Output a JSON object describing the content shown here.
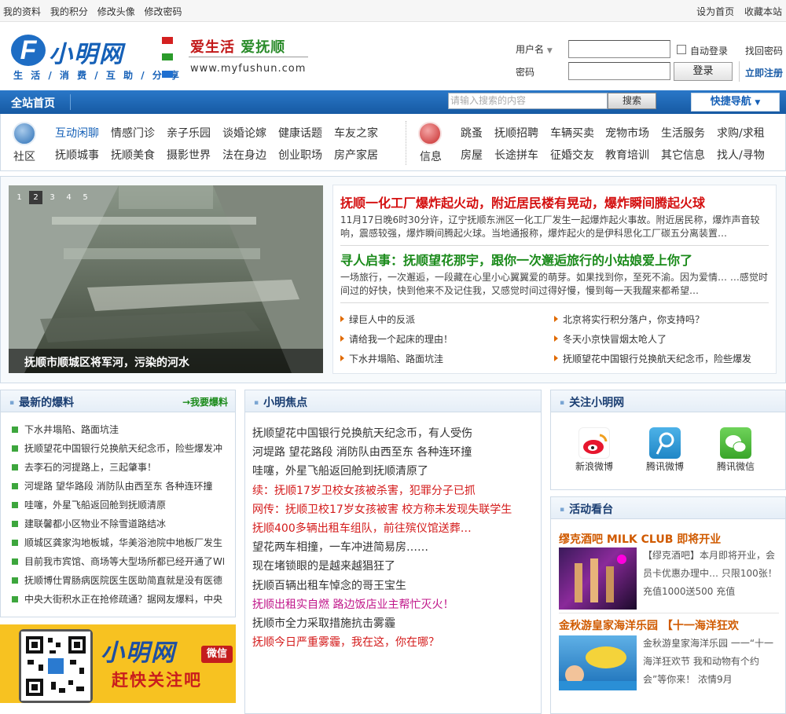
{
  "topbar": {
    "left_links": [
      "我的资料",
      "我的积分",
      "修改头像",
      "修改密码"
    ],
    "right_links": [
      "设为首页",
      "收藏本站"
    ]
  },
  "logo": {
    "f": "F",
    "name": "小明网",
    "tagline": "生 活 / 消 费 / 互 助 / 分 享"
  },
  "slogan": {
    "part1": "爱生活",
    "part2": "爱抚顺",
    "url": "www.myfushun.com"
  },
  "login": {
    "username_label": "用户名",
    "password_label": "密码",
    "auto_login": "自动登录",
    "login_button": "登录",
    "find_password": "找回密码",
    "register": "立即注册"
  },
  "nav": {
    "home": "全站首页",
    "search_placeholder": "请输入搜索的内容",
    "search_button": "搜索",
    "quick_nav": "快捷导航"
  },
  "community": {
    "label": "社区",
    "row1": [
      "互动闲聊",
      "情感门诊",
      "亲子乐园",
      "谈婚论嫁",
      "健康话题",
      "车友之家"
    ],
    "row2": [
      "抚顺城事",
      "抚顺美食",
      "摄影世界",
      "法在身边",
      "创业职场",
      "房产家居"
    ]
  },
  "info": {
    "label": "信息",
    "row1": [
      "跳蚤",
      "抚顺招聘",
      "车辆买卖",
      "宠物市场",
      "生活服务",
      "求购/求租"
    ],
    "row2": [
      "房屋",
      "长途拼车",
      "征婚交友",
      "教育培训",
      "其它信息",
      "找人/寻物"
    ]
  },
  "slideshow": {
    "numbers": [
      "1",
      "2",
      "3",
      "4",
      "5"
    ],
    "caption": "抚顺市顺城区将军河，污染的河水"
  },
  "headlines": [
    {
      "title": "抚顺一化工厂爆炸起火动，附近居民楼有晃动，爆炸瞬间腾起火球",
      "summary": "11月17日晚6时30分许，辽宁抚顺东洲区一化工厂发生一起爆炸起火事故。附近居民称，爆炸声音较响，震感较强，爆炸瞬间腾起火球。当地通报称，爆炸起火的是伊科思化工厂碳五分离装置…"
    },
    {
      "title": "寻人启事：抚顺望花那宇，跟你一次邂逅旅行的小姑娘爱上你了",
      "summary": "一场旅行，一次邂逅，一段藏在心里小心翼翼爱的萌芽。如果找到你，至死不渝。因为爱情… …感觉时间过的好快，快到他来不及记住我，又感觉时间过得好慢，慢到每一天我醒来都希望…"
    }
  ],
  "headline_links_left": [
    "绿巨人中的反派",
    "请给我一个起床的理由！",
    "下水井塌陷、路面坑洼"
  ],
  "headline_links_right": [
    "北京将实行积分落户，你支持吗？",
    "冬天小京快冒烟太呛人了",
    "抚顺望花中国银行兑换航天纪念币，险些爆发"
  ],
  "baoliao": {
    "title": "最新的爆料",
    "action": "→我要爆料",
    "items": [
      "下水井塌陷、路面坑洼",
      "抚顺望花中国银行兑换航天纪念币，险些爆发冲",
      "去李石的河提路上，三起肇事！",
      "河堤路 望华路段 消防队由西至东 各种连环撞",
      "哇噻，外星飞船返回舱到抚顺清原",
      "建联馨都小区物业不除雪道路结冰",
      "顺城区龚家沟地板城，华美浴池院中地板厂发生",
      "目前我市宾馆、商场等大型场所都已经开通了WI",
      "抚顺博仕胃肠病医院医生医助简直就是没有医德",
      "中央大街积水正在抢修疏通？据网友爆料，中央"
    ]
  },
  "banner": {
    "title": "小明网",
    "subtitle": "赶快关注吧",
    "tag": "微信"
  },
  "focus": {
    "title": "小明焦点",
    "items": [
      {
        "text": "抚顺望花中国银行兑换航天纪念币，有人受伤",
        "style": "normal"
      },
      {
        "text": "河堤路 望花路段 消防队由西至东 各种连环撞",
        "style": "normal"
      },
      {
        "text": "哇噻，外星飞船返回舱到抚顺清原了",
        "style": "normal"
      },
      {
        "text": "续：抚顺17岁卫校女孩被杀害，犯罪分子已抓",
        "style": "red"
      },
      {
        "text": "网传：抚顺卫校17岁女孩被害 校方称未发现失联学生",
        "style": "red"
      },
      {
        "text": "抚顺400多辆出租车组队，前往殡仪馆送葬…",
        "style": "red"
      },
      {
        "text": "望花两车相撞，一车冲进简易房……",
        "style": "normal"
      },
      {
        "text": "现在堵锁眼的是越来越猖狂了",
        "style": "normal"
      },
      {
        "text": "抚顺百辆出租车悼念的哥王宝生",
        "style": "normal"
      },
      {
        "text": "抚顺出租实自燃 路边饭店业主帮忙灭火！",
        "style": "mag"
      },
      {
        "text": "抚顺市全力采取措施抗击雾霾",
        "style": "normal"
      },
      {
        "text": "抚顺今日严重雾霾，我在这，你在哪？",
        "style": "red"
      }
    ]
  },
  "follow": {
    "title": "关注小明网",
    "items": [
      "新浪微博",
      "腾讯微博",
      "腾讯微信"
    ]
  },
  "events": {
    "title": "活动看台",
    "items": [
      {
        "title": "缪克酒吧 MILK CLUB 即将开业",
        "text": "【缪克酒吧】本月即将开业，会员卡优惠办理中… 只限100张！充值1000送500 充值"
      },
      {
        "title": "金秋游皇家海洋乐园 【十一海洋狂欢",
        "text": "金秋游皇家海洋乐园 一一“十一海洋狂欢节 我和动物有个约会”等你来！ 浓情9月"
      }
    ]
  },
  "colors": {
    "brand_blue": "#1560b7",
    "headline_red": "#d40f0f",
    "headline_green": "#1a8a1a",
    "accent_orange": "#d05a00"
  }
}
